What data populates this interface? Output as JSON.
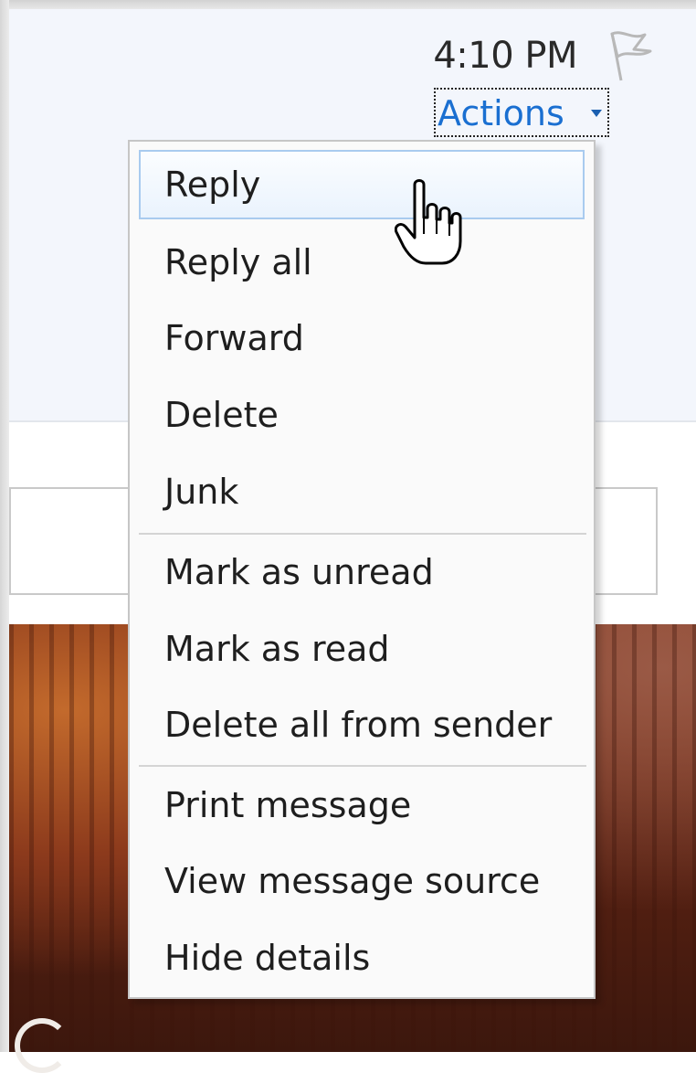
{
  "header": {
    "time": "4:10 PM",
    "actions_label": "Actions"
  },
  "icons": {
    "flag": "flag-icon",
    "dropdown": "chevron-down-icon",
    "cursor": "hand-pointer-cursor"
  },
  "menu": {
    "items": [
      {
        "label": "Reply",
        "state": "hover"
      },
      {
        "label": "Reply all"
      },
      {
        "label": "Forward"
      },
      {
        "label": "Delete"
      },
      {
        "label": "Junk"
      },
      {
        "label": "Mark as unread"
      },
      {
        "label": "Mark as read"
      },
      {
        "label": "Delete all from sender"
      },
      {
        "label": "Print message"
      },
      {
        "label": "View message source"
      },
      {
        "label": "Hide details"
      }
    ]
  },
  "colors": {
    "link": "#1a6fd1",
    "hover_border": "#a9cbef",
    "header_bg": "#f3f6fc"
  }
}
